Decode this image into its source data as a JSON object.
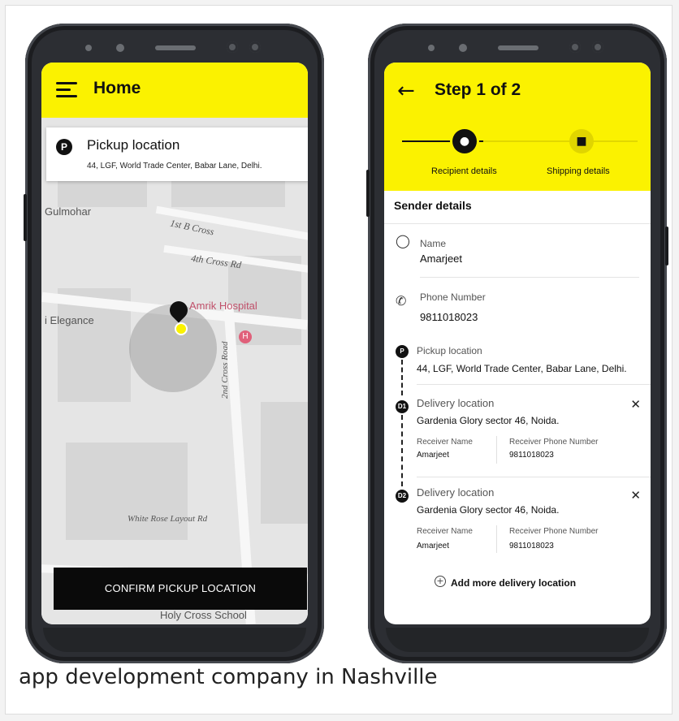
{
  "phone1": {
    "header_title": "Home",
    "pickup_card": {
      "badge": "P",
      "title": "Pickup location",
      "address": "44, LGF, World Trade Center, Babar Lane, Delhi."
    },
    "map_labels": {
      "gulmohar": "Gulmohar",
      "first_b_cross": "1st B Cross",
      "fourth_cross": "4th Cross Rd",
      "amrik": "Amrik Hospital",
      "elegance": "i Elegance",
      "second_cross": "2nd Cross Road",
      "white_rose": "White Rose Layout Rd",
      "holy_cross": "Holy Cross School"
    },
    "hospital_marker": "H",
    "confirm_button": "CONFIRM PICKUP LOCATION"
  },
  "phone2": {
    "header_title": "Step 1 of 2",
    "steps": [
      {
        "label": "Recipient details"
      },
      {
        "label": "Shipping details"
      }
    ],
    "section_title": "Sender details",
    "name_label": "Name",
    "name_value": "Amarjeet",
    "phone_label": "Phone Number",
    "phone_value": "9811018023",
    "pickup": {
      "marker": "P",
      "label": "Pickup location",
      "address": "44, LGF, World Trade Center, Babar Lane, Delhi."
    },
    "deliveries": [
      {
        "marker": "D1",
        "label": "Delivery location",
        "address": "Gardenia Glory sector 46, Noida.",
        "receiver_name_label": "Receiver Name",
        "receiver_name": "Amarjeet",
        "receiver_phone_label": "Receiver Phone Number",
        "receiver_phone": "9811018023"
      },
      {
        "marker": "D2",
        "label": "Delivery location",
        "address": "Gardenia Glory sector 46, Noida.",
        "receiver_name_label": "Receiver Name",
        "receiver_name": "Amarjeet",
        "receiver_phone_label": "Receiver Phone Number",
        "receiver_phone": "9811018023"
      }
    ],
    "add_more": "Add more delivery location"
  },
  "caption": "app development company in Nashville",
  "colors": {
    "accent": "#fbf200",
    "dark": "#111111"
  }
}
